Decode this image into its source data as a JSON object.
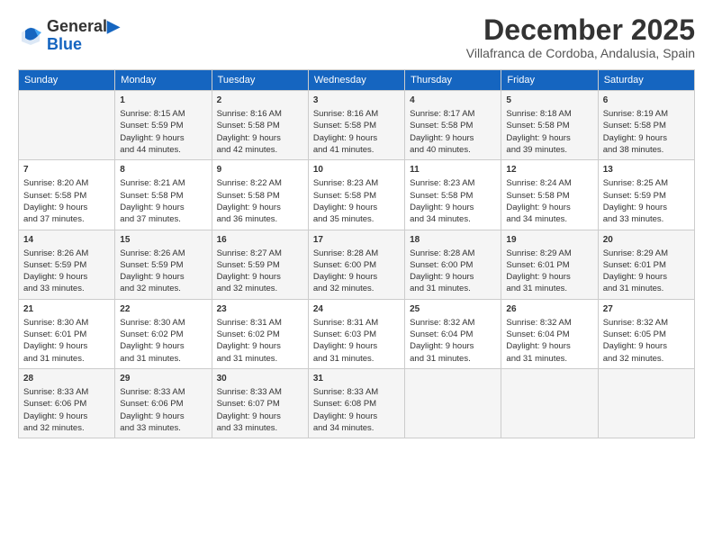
{
  "logo": {
    "line1": "General",
    "line2": "Blue"
  },
  "title": "December 2025",
  "subtitle": "Villafranca de Cordoba, Andalusia, Spain",
  "days_header": [
    "Sunday",
    "Monday",
    "Tuesday",
    "Wednesday",
    "Thursday",
    "Friday",
    "Saturday"
  ],
  "weeks": [
    [
      {
        "day": "",
        "content": ""
      },
      {
        "day": "1",
        "content": "Sunrise: 8:15 AM\nSunset: 5:59 PM\nDaylight: 9 hours\nand 44 minutes."
      },
      {
        "day": "2",
        "content": "Sunrise: 8:16 AM\nSunset: 5:58 PM\nDaylight: 9 hours\nand 42 minutes."
      },
      {
        "day": "3",
        "content": "Sunrise: 8:16 AM\nSunset: 5:58 PM\nDaylight: 9 hours\nand 41 minutes."
      },
      {
        "day": "4",
        "content": "Sunrise: 8:17 AM\nSunset: 5:58 PM\nDaylight: 9 hours\nand 40 minutes."
      },
      {
        "day": "5",
        "content": "Sunrise: 8:18 AM\nSunset: 5:58 PM\nDaylight: 9 hours\nand 39 minutes."
      },
      {
        "day": "6",
        "content": "Sunrise: 8:19 AM\nSunset: 5:58 PM\nDaylight: 9 hours\nand 38 minutes."
      }
    ],
    [
      {
        "day": "7",
        "content": "Sunrise: 8:20 AM\nSunset: 5:58 PM\nDaylight: 9 hours\nand 37 minutes."
      },
      {
        "day": "8",
        "content": "Sunrise: 8:21 AM\nSunset: 5:58 PM\nDaylight: 9 hours\nand 37 minutes."
      },
      {
        "day": "9",
        "content": "Sunrise: 8:22 AM\nSunset: 5:58 PM\nDaylight: 9 hours\nand 36 minutes."
      },
      {
        "day": "10",
        "content": "Sunrise: 8:23 AM\nSunset: 5:58 PM\nDaylight: 9 hours\nand 35 minutes."
      },
      {
        "day": "11",
        "content": "Sunrise: 8:23 AM\nSunset: 5:58 PM\nDaylight: 9 hours\nand 34 minutes."
      },
      {
        "day": "12",
        "content": "Sunrise: 8:24 AM\nSunset: 5:58 PM\nDaylight: 9 hours\nand 34 minutes."
      },
      {
        "day": "13",
        "content": "Sunrise: 8:25 AM\nSunset: 5:59 PM\nDaylight: 9 hours\nand 33 minutes."
      }
    ],
    [
      {
        "day": "14",
        "content": "Sunrise: 8:26 AM\nSunset: 5:59 PM\nDaylight: 9 hours\nand 33 minutes."
      },
      {
        "day": "15",
        "content": "Sunrise: 8:26 AM\nSunset: 5:59 PM\nDaylight: 9 hours\nand 32 minutes."
      },
      {
        "day": "16",
        "content": "Sunrise: 8:27 AM\nSunset: 5:59 PM\nDaylight: 9 hours\nand 32 minutes."
      },
      {
        "day": "17",
        "content": "Sunrise: 8:28 AM\nSunset: 6:00 PM\nDaylight: 9 hours\nand 32 minutes."
      },
      {
        "day": "18",
        "content": "Sunrise: 8:28 AM\nSunset: 6:00 PM\nDaylight: 9 hours\nand 31 minutes."
      },
      {
        "day": "19",
        "content": "Sunrise: 8:29 AM\nSunset: 6:01 PM\nDaylight: 9 hours\nand 31 minutes."
      },
      {
        "day": "20",
        "content": "Sunrise: 8:29 AM\nSunset: 6:01 PM\nDaylight: 9 hours\nand 31 minutes."
      }
    ],
    [
      {
        "day": "21",
        "content": "Sunrise: 8:30 AM\nSunset: 6:01 PM\nDaylight: 9 hours\nand 31 minutes."
      },
      {
        "day": "22",
        "content": "Sunrise: 8:30 AM\nSunset: 6:02 PM\nDaylight: 9 hours\nand 31 minutes."
      },
      {
        "day": "23",
        "content": "Sunrise: 8:31 AM\nSunset: 6:02 PM\nDaylight: 9 hours\nand 31 minutes."
      },
      {
        "day": "24",
        "content": "Sunrise: 8:31 AM\nSunset: 6:03 PM\nDaylight: 9 hours\nand 31 minutes."
      },
      {
        "day": "25",
        "content": "Sunrise: 8:32 AM\nSunset: 6:04 PM\nDaylight: 9 hours\nand 31 minutes."
      },
      {
        "day": "26",
        "content": "Sunrise: 8:32 AM\nSunset: 6:04 PM\nDaylight: 9 hours\nand 31 minutes."
      },
      {
        "day": "27",
        "content": "Sunrise: 8:32 AM\nSunset: 6:05 PM\nDaylight: 9 hours\nand 32 minutes."
      }
    ],
    [
      {
        "day": "28",
        "content": "Sunrise: 8:33 AM\nSunset: 6:06 PM\nDaylight: 9 hours\nand 32 minutes."
      },
      {
        "day": "29",
        "content": "Sunrise: 8:33 AM\nSunset: 6:06 PM\nDaylight: 9 hours\nand 33 minutes."
      },
      {
        "day": "30",
        "content": "Sunrise: 8:33 AM\nSunset: 6:07 PM\nDaylight: 9 hours\nand 33 minutes."
      },
      {
        "day": "31",
        "content": "Sunrise: 8:33 AM\nSunset: 6:08 PM\nDaylight: 9 hours\nand 34 minutes."
      },
      {
        "day": "",
        "content": ""
      },
      {
        "day": "",
        "content": ""
      },
      {
        "day": "",
        "content": ""
      }
    ]
  ]
}
